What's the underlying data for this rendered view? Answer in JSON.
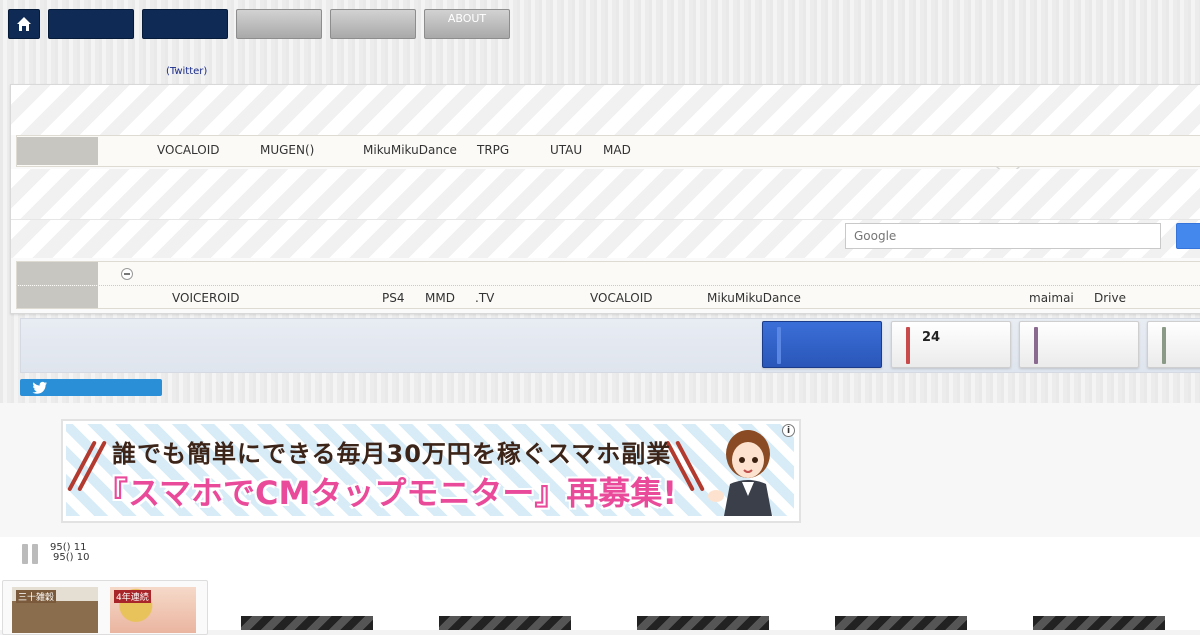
{
  "nav": {
    "about_label": "ABOUT",
    "twitter_link": "(Twitter)"
  },
  "categories_row1": [
    "VOCALOID",
    "MUGEN()",
    "MikuMikuDance",
    "TRPG",
    "UTAU",
    "MAD"
  ],
  "search": {
    "placeholder": "Google"
  },
  "categories_row2": [
    "VOICEROID",
    "PS4",
    "MMD",
    ".TV",
    "VOCALOID",
    "MikuMikuDance",
    "maimai",
    "Drive"
  ],
  "ranking": {
    "count": "24",
    "bar_colors": [
      "#c94a4a",
      "#8a6a8f",
      "#8a9a86"
    ]
  },
  "ad": {
    "line1": "誰でも簡単にできる毎月30万円を稼ぐスマホ副業",
    "line2": "『スマホでCMタップモニター』再募集!",
    "info_glyph": "i"
  },
  "ticker": {
    "line1": "95() 11",
    "line2": "95() 10"
  },
  "books": {
    "book1_label": "三十雑穀",
    "book2_label": "4年連続"
  },
  "colors": {
    "nav_dark": "#0e2a55",
    "search_button": "#4488ee",
    "twitter_blue": "#2a8fd6",
    "active_card": "#3b6fd8"
  }
}
